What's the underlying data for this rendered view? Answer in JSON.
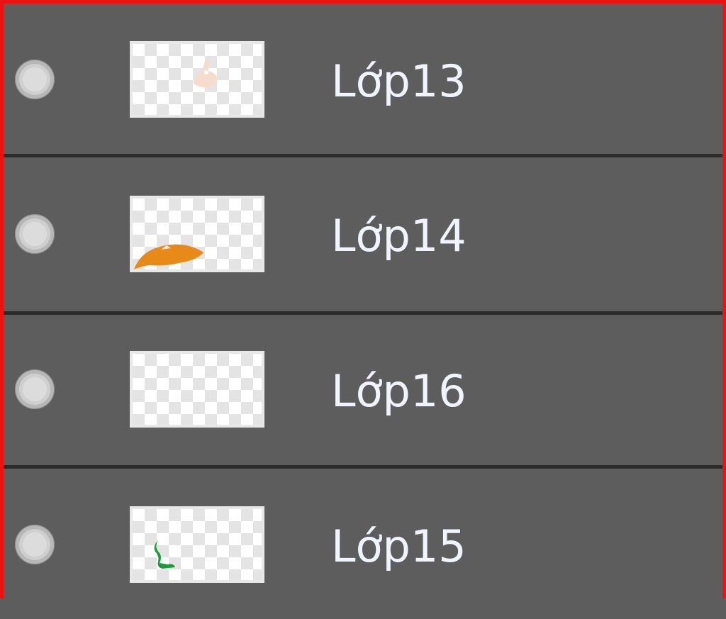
{
  "layers": [
    {
      "name": "Lớp13",
      "thumbnail_icon": "hand-sketch-icon",
      "thumbnail_color": "#f5d9c8"
    },
    {
      "name": "Lớp14",
      "thumbnail_icon": "orange-fish-shape-icon",
      "thumbnail_color": "#e88a1a"
    },
    {
      "name": "Lớp16",
      "thumbnail_icon": "empty-transparent-icon",
      "thumbnail_color": "#ffffff"
    },
    {
      "name": "Lớp15",
      "thumbnail_icon": "green-sprout-icon",
      "thumbnail_color": "#1f9a3a"
    }
  ],
  "colors": {
    "panel_border": "#ee1111",
    "row_background": "#5d5d5d",
    "divider": "#2b2b2b",
    "label_text": "#f0f4ff"
  }
}
